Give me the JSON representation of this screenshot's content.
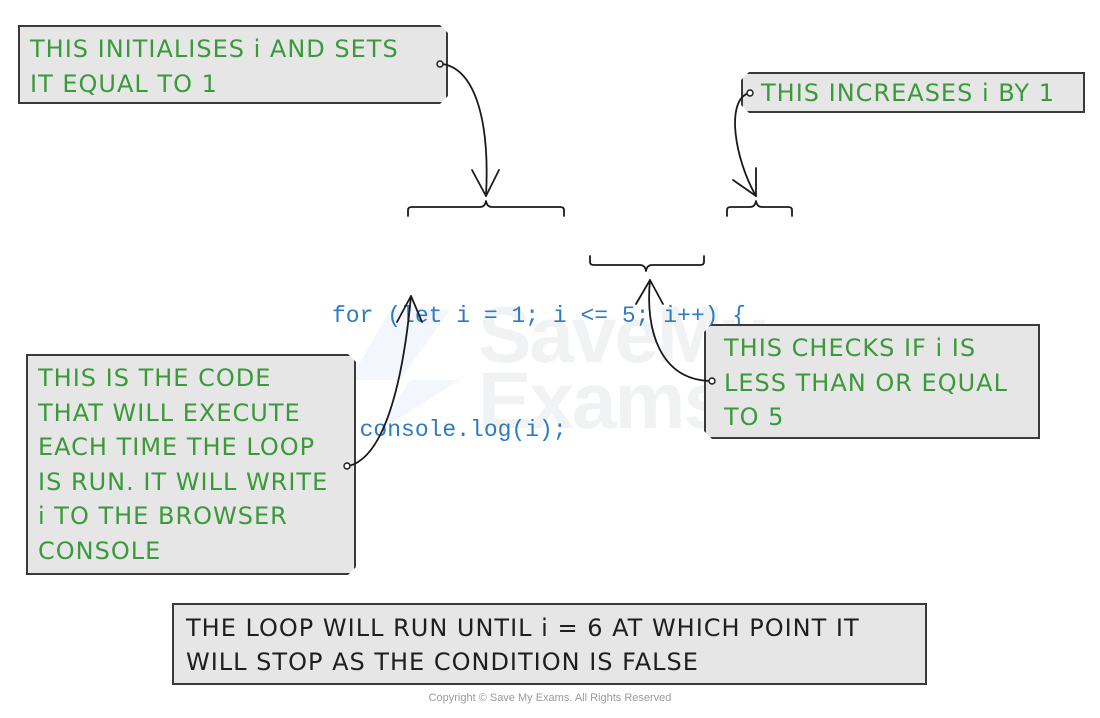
{
  "watermark": {
    "line1": "SaveMy",
    "line2": "Exams"
  },
  "code": {
    "lines": [
      "for (let i = 1; i <= 5; i++) {",
      "  console.log(i);",
      "{"
    ]
  },
  "callouts": {
    "initialise": {
      "lines": [
        "THIS INITIALISES i AND SETS",
        "IT EQUAL TO 1"
      ]
    },
    "increment": {
      "lines": [
        "THIS INCREASES i BY 1"
      ]
    },
    "body": {
      "lines": [
        "THIS IS THE CODE",
        "THAT WILL EXECUTE",
        "EACH TIME THE LOOP",
        "IS RUN. IT WILL WRITE",
        "i TO THE BROWSER",
        "CONSOLE"
      ]
    },
    "condition": {
      "lines": [
        "THIS CHECKS IF i IS",
        "LESS THAN OR EQUAL",
        "TO 5"
      ]
    }
  },
  "summary": {
    "lines": [
      "THE LOOP WILL RUN UNTIL i = 6 AT WHICH POINT IT",
      "WILL STOP AS THE CONDITION IS FALSE"
    ]
  },
  "copyright": "Copyright © Save My Exams. All Rights Reserved",
  "colors": {
    "callout_text": "#3a9a3a",
    "code_text": "#2e7bc4",
    "callout_bg": "#e6e6e6",
    "border": "#3a3a3a"
  }
}
